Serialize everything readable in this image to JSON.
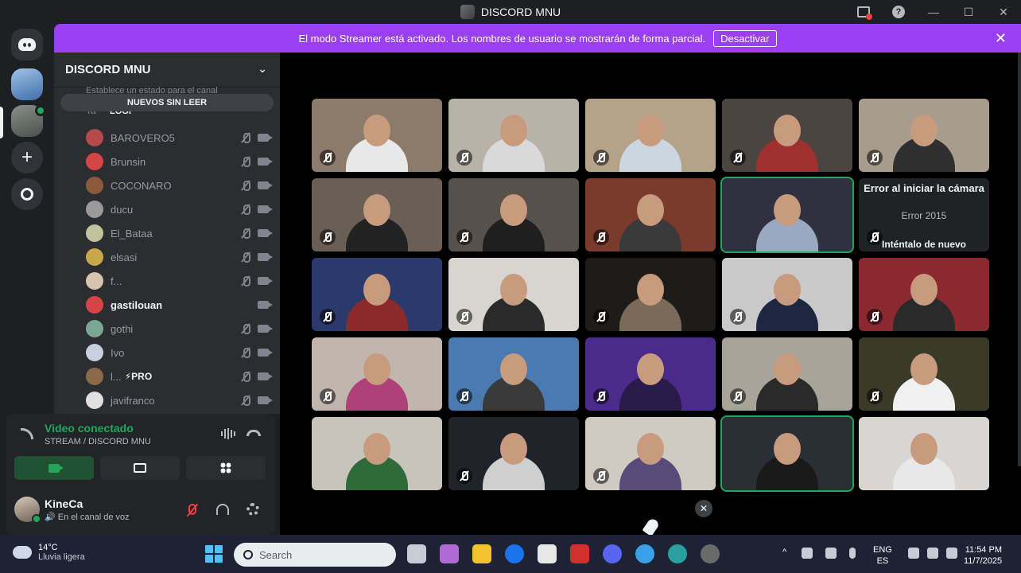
{
  "window": {
    "title": "DISCORD MNU"
  },
  "banner": {
    "message": "El modo Streamer está activado. Los nombres de usuario se mostrarán de forma parcial.",
    "deactivate_label": "Desactivar"
  },
  "sidebar": {
    "server_name": "DISCORD MNU",
    "status_hint": "Establece un estado para el canal",
    "unread_label": "NUEVOS SIN LEER",
    "partial_row": {
      "name": "Ta",
      "badge": "LOGI"
    },
    "members": [
      {
        "name": "BAROVERO5",
        "color": "#b44a4a",
        "active": false,
        "mic_muted": true
      },
      {
        "name": "Brunsin",
        "color": "#d64545",
        "active": false,
        "mic_muted": true
      },
      {
        "name": "COCONARO",
        "color": "#8b5a3c",
        "active": false,
        "mic_muted": true
      },
      {
        "name": "ducu",
        "color": "#9a9a9a",
        "active": false,
        "mic_muted": true
      },
      {
        "name": "El_Bataa",
        "color": "#c0c49a",
        "active": false,
        "mic_muted": true
      },
      {
        "name": "elsasi",
        "color": "#c9a64a",
        "active": false,
        "mic_muted": true
      },
      {
        "name": "f...",
        "color": "#d8c3b0",
        "active": false,
        "mic_muted": true
      },
      {
        "name": "gastilouan",
        "color": "#d64545",
        "active": true,
        "mic_muted": false
      },
      {
        "name": "gothi",
        "color": "#7aa891",
        "active": false,
        "mic_muted": true
      },
      {
        "name": "Ivo",
        "color": "#c8d0e0",
        "active": false,
        "mic_muted": true
      },
      {
        "name": "l...",
        "color": "#8a6a4a",
        "active": false,
        "mic_muted": true,
        "badge": "⚡PRO"
      },
      {
        "name": "javifranco",
        "color": "#e0e0e0",
        "active": false,
        "mic_muted": true
      }
    ]
  },
  "voice": {
    "status": "Video conectado",
    "channel": "STREAM / DISCORD MNU"
  },
  "user": {
    "name": "KineCa",
    "status": "En el canal de voz"
  },
  "stage": {
    "tiles": [
      {
        "bg": "#8c7a6a",
        "shirt": "#e8e8e8",
        "muted": true,
        "speaking": false
      },
      {
        "bg": "#b9b2a8",
        "shirt": "#d9d9d9",
        "muted": true,
        "speaking": false
      },
      {
        "bg": "#b5a289",
        "shirt": "#cbd6e0",
        "muted": true,
        "speaking": false
      },
      {
        "bg": "#4b4440",
        "shirt": "#a0302e",
        "muted": true,
        "speaking": false
      },
      {
        "bg": "#a89c8c",
        "shirt": "#2f2f2f",
        "muted": true,
        "speaking": false
      },
      {
        "bg": "#6a5f55",
        "shirt": "#222222",
        "muted": true,
        "speaking": false
      },
      {
        "bg": "#58504a",
        "shirt": "#1f1f1f",
        "muted": true,
        "speaking": false
      },
      {
        "bg": "#7a3a2c",
        "shirt": "#3a3a3a",
        "muted": true,
        "speaking": false
      },
      {
        "bg": "#2f3140",
        "shirt": "#9aa8c0",
        "muted": false,
        "speaking": true
      },
      {
        "error": true,
        "muted": true,
        "speaking": false
      },
      {
        "bg": "#2a3a6a",
        "shirt": "#8a2a2a",
        "muted": true,
        "speaking": false
      },
      {
        "bg": "#d8d4cf",
        "shirt": "#2a2a2a",
        "muted": true,
        "speaking": false
      },
      {
        "bg": "#1f1b19",
        "shirt": "#7a6a5a",
        "muted": true,
        "speaking": false
      },
      {
        "bg": "#c9c9c9",
        "shirt": "#1e2740",
        "muted": true,
        "speaking": false
      },
      {
        "bg": "#8a2a30",
        "shirt": "#2a2a2a",
        "muted": true,
        "speaking": false
      },
      {
        "bg": "#c0b6ad",
        "shirt": "#b0407a",
        "muted": true,
        "speaking": false
      },
      {
        "bg": "#4a7ab0",
        "shirt": "#3a3a3a",
        "muted": true,
        "speaking": false
      },
      {
        "bg": "#4a2a8a",
        "shirt": "#2a1a4a",
        "muted": true,
        "speaking": false
      },
      {
        "bg": "#a8a49a",
        "shirt": "#2a2a2a",
        "muted": true,
        "speaking": false
      },
      {
        "bg": "#3a3a28",
        "shirt": "#f0f0f0",
        "muted": true,
        "speaking": false
      },
      {
        "bg": "#c8c4bc",
        "shirt": "#2f6a3a",
        "muted": false,
        "speaking": false
      },
      {
        "bg": "#20242a",
        "shirt": "#cfcfcf",
        "muted": true,
        "speaking": false
      },
      {
        "bg": "#cfcac2",
        "shirt": "#5a4a7a",
        "muted": true,
        "speaking": false
      },
      {
        "bg": "#2a2f35",
        "shirt": "#1a1a1a",
        "muted": false,
        "speaking": true
      },
      {
        "bg": "#d8d6d2",
        "shirt": "#e8e8e8",
        "muted": false,
        "speaking": false
      }
    ],
    "error_tile": {
      "title": "Error al iniciar la cámara",
      "code": "Error 2015",
      "retry": "Inténtalo de nuevo"
    }
  },
  "taskbar": {
    "weather_temp": "14°C",
    "weather_desc": "Lluvia ligera",
    "search_placeholder": "Search",
    "lang_top": "ENG",
    "lang_bottom": "ES",
    "time": "11:54 PM",
    "date": "11/7/2025",
    "app_colors": [
      "#c9ccd4",
      "#b06ad8",
      "#f2c230",
      "#1a73e8",
      "#e8e8e8",
      "#d32f2f",
      "#5865f2",
      "#3aa0e8",
      "#2aa0a0",
      "#6a6a6a"
    ]
  }
}
